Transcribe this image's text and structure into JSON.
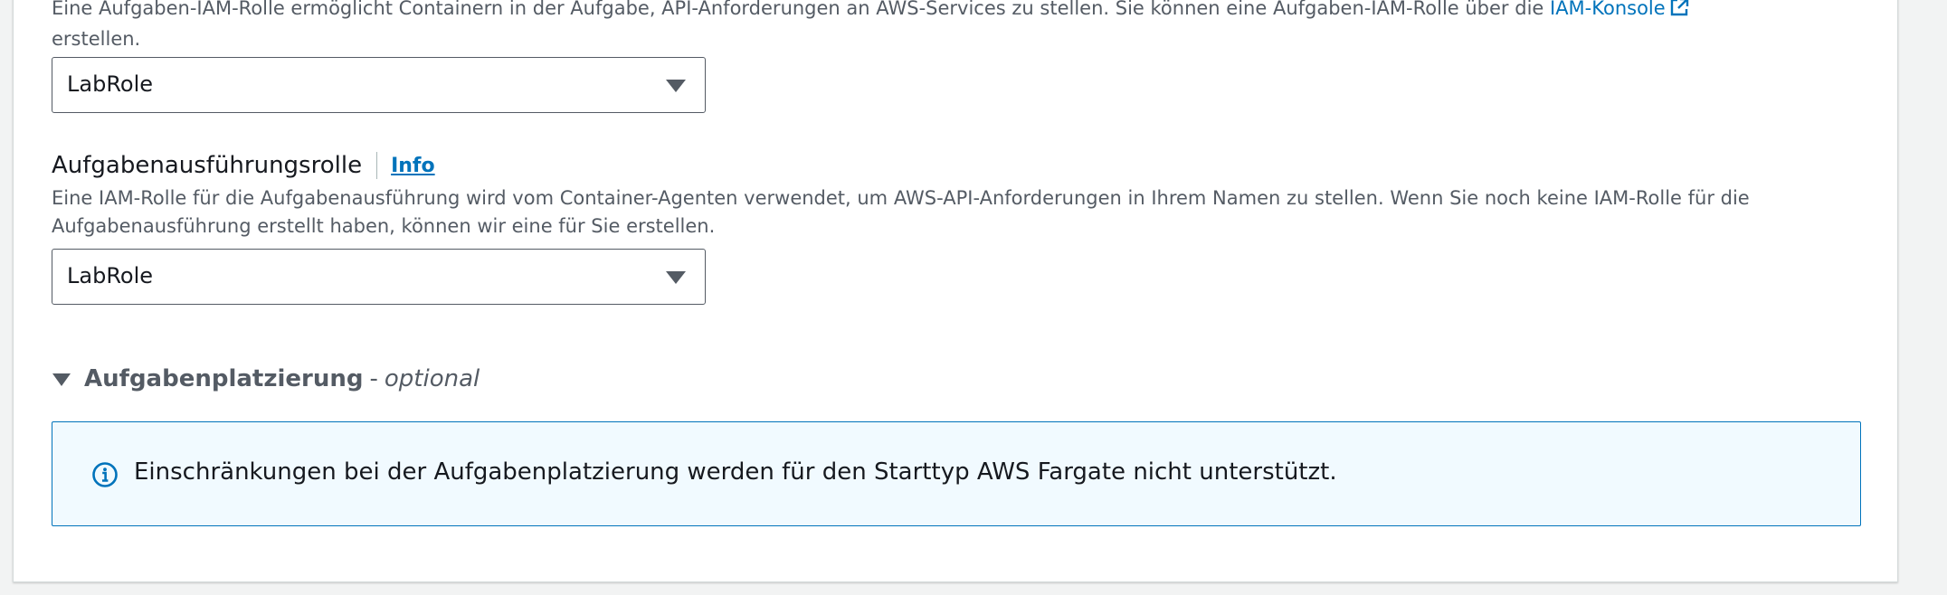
{
  "task_role": {
    "description": "Eine Aufgaben-IAM-Rolle ermöglicht Containern in der Aufgabe, API-Anforderungen an AWS-Services zu stellen. Sie können eine Aufgaben-IAM-Rolle über die ",
    "link_text": "IAM-Konsole",
    "description_suffix": "erstellen.",
    "selected_value": "LabRole"
  },
  "execution_role": {
    "label": "Aufgabenausführungsrolle",
    "info_label": "Info",
    "description": "Eine IAM-Rolle für die Aufgabenausführung wird vom Container-Agenten verwendet, um AWS-API-Anforderungen in Ihrem Namen zu stellen. Wenn Sie noch keine IAM-Rolle für die Aufgabenausführung erstellt haben, können wir eine für Sie erstellen.",
    "selected_value": "LabRole"
  },
  "task_placement": {
    "title": "Aufgabenplatzierung",
    "separator": "-",
    "optional_label": "optional",
    "expanded": true,
    "alert_text": "Einschränkungen bei der Aufgabenplatzierung werden für den Starttyp AWS Fargate nicht unterstützt."
  },
  "colors": {
    "link": "#0073bb",
    "alert_background": "#f1faff",
    "alert_border": "#0073bb",
    "secondary_text": "#545b64",
    "page_background": "#f2f3f3"
  },
  "icons": {
    "external_link": "external-link-icon",
    "dropdown": "caret-down-icon",
    "expander": "caret-down-icon",
    "info": "info-circle-icon"
  }
}
